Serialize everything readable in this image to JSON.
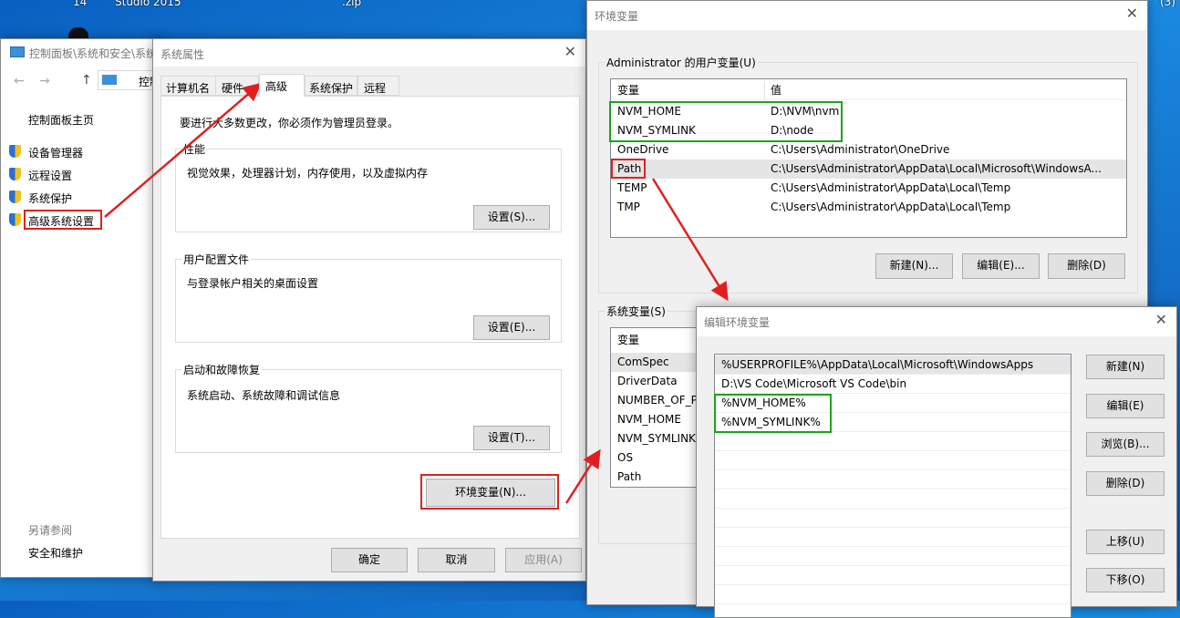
{
  "desktop": {
    "icon_labels": [
      "14",
      "Studio 2015",
      ".zip",
      "...",
      "(3)"
    ]
  },
  "control_panel": {
    "title": "控制面板\\系统和安全\\系统",
    "address": "控制",
    "home_link": "控制面板主页",
    "links": [
      "设备管理器",
      "远程设置",
      "系统保护",
      "高级系统设置"
    ],
    "see_also": "另请参阅",
    "security_link": "安全和维护"
  },
  "system_properties": {
    "title": "系统属性",
    "tabs": [
      "计算机名",
      "硬件",
      "高级",
      "系统保护",
      "远程"
    ],
    "active_tab": "高级",
    "admin_note": "要进行大多数更改，你必须作为管理员登录。",
    "performance": {
      "label": "性能",
      "desc": "视觉效果，处理器计划，内存使用，以及虚拟内存",
      "button": "设置(S)..."
    },
    "user_profiles": {
      "label": "用户配置文件",
      "desc": "与登录帐户相关的桌面设置",
      "button": "设置(E)..."
    },
    "startup": {
      "label": "启动和故障恢复",
      "desc": "系统启动、系统故障和调试信息",
      "button": "设置(T)..."
    },
    "env_button": "环境变量(N)...",
    "ok": "确定",
    "cancel": "取消",
    "apply": "应用(A)"
  },
  "env_vars": {
    "title": "环境变量",
    "user_group": "Administrator 的用户变量(U)",
    "col_var": "变量",
    "col_val": "值",
    "user_rows": [
      {
        "name": "NVM_HOME",
        "value": "D:\\NVM\\nvm"
      },
      {
        "name": "NVM_SYMLINK",
        "value": "D:\\node"
      },
      {
        "name": "OneDrive",
        "value": "C:\\Users\\Administrator\\OneDrive"
      },
      {
        "name": "Path",
        "value": "C:\\Users\\Administrator\\AppData\\Local\\Microsoft\\WindowsA..."
      },
      {
        "name": "TEMP",
        "value": "C:\\Users\\Administrator\\AppData\\Local\\Temp"
      },
      {
        "name": "TMP",
        "value": "C:\\Users\\Administrator\\AppData\\Local\\Temp"
      }
    ],
    "new": "新建(N)...",
    "edit": "编辑(E)...",
    "delete": "删除(D)",
    "system_group": "系统变量(S)",
    "system_rows": [
      "ComSpec",
      "DriverData",
      "NUMBER_OF_PI",
      "NVM_HOME",
      "NVM_SYMLINK",
      "OS",
      "Path"
    ]
  },
  "edit_env": {
    "title": "编辑环境变量",
    "entries": [
      "%USERPROFILE%\\AppData\\Local\\Microsoft\\WindowsApps",
      "D:\\VS Code\\Microsoft VS Code\\bin",
      "%NVM_HOME%",
      "%NVM_SYMLINK%"
    ],
    "buttons": [
      "新建(N)",
      "编辑(E)",
      "浏览(B)...",
      "删除(D)",
      "上移(U)",
      "下移(O)"
    ]
  },
  "colors": {
    "annotation_red": "#e02020",
    "annotation_green": "#1aa51a",
    "desktop": "#1a7fd6"
  }
}
